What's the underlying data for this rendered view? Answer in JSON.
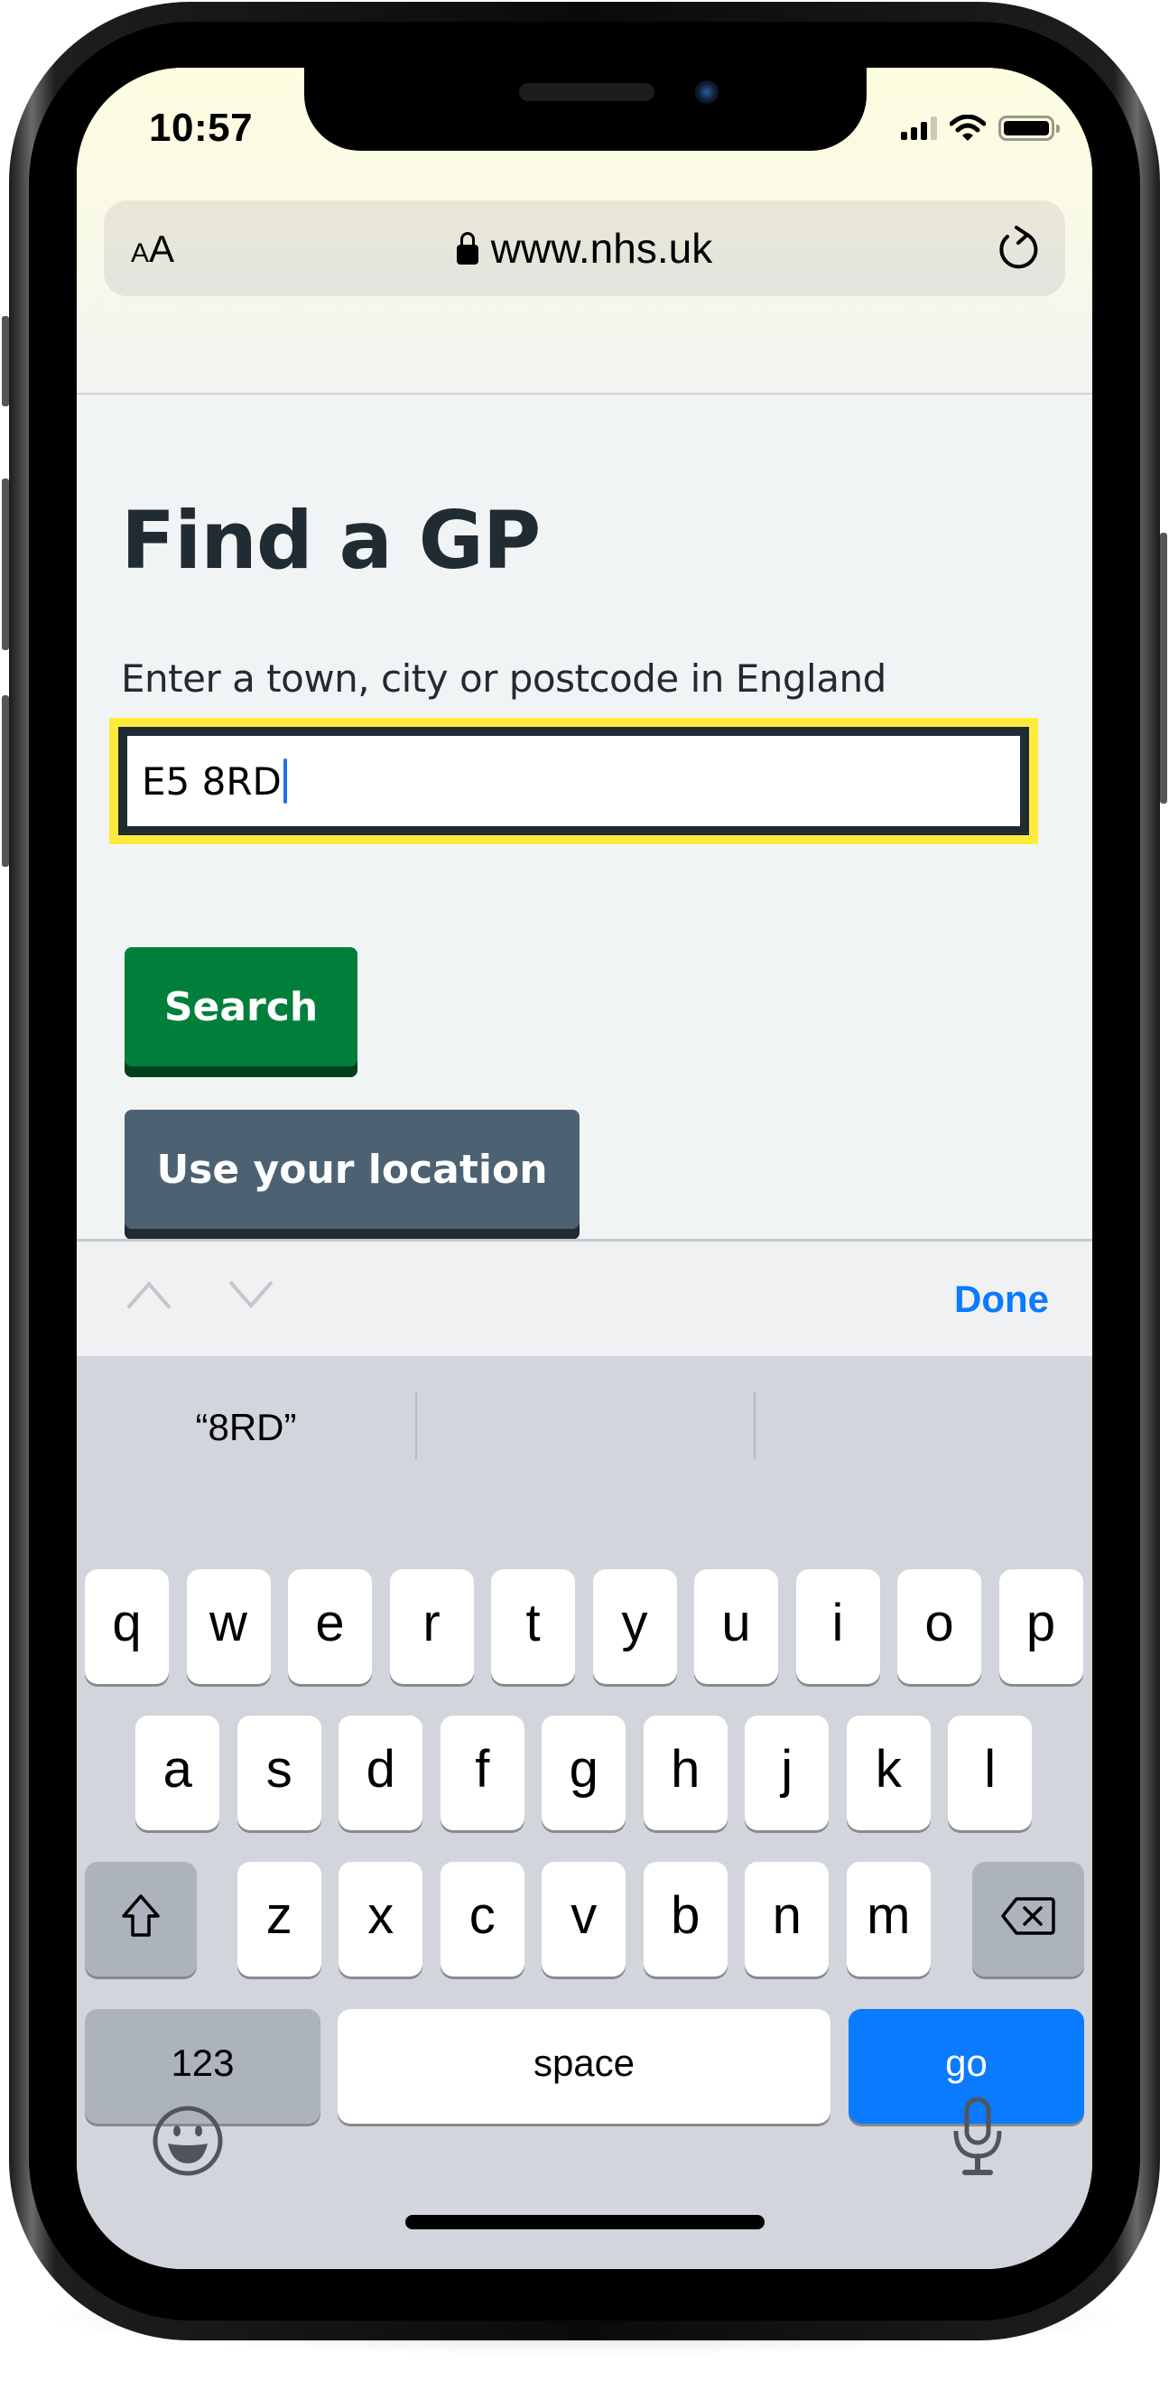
{
  "status_bar": {
    "time": "10:57",
    "icons": [
      "signal-icon",
      "wifi-icon",
      "battery-icon"
    ]
  },
  "browser": {
    "text_size_label_small": "A",
    "text_size_label_big": "A",
    "url": "www.nhs.uk",
    "lock_icon": "lock-icon",
    "reload_icon": "reload-icon"
  },
  "page": {
    "title": "Find a GP",
    "search_label": "Enter a town, city or postcode in England",
    "search_value": "E5 8RD",
    "search_button": "Search",
    "location_button": "Use your location",
    "colors": {
      "focus": "#ffeb3b",
      "primary_button": "#007f3b",
      "secondary_button": "#4c6272",
      "text": "#212b32"
    }
  },
  "accessory_bar": {
    "prev_icon": "chevron-up-icon",
    "next_icon": "chevron-down-icon",
    "done_label": "Done"
  },
  "keyboard": {
    "suggestions": [
      "“8RD”",
      "",
      ""
    ],
    "row1": [
      "q",
      "w",
      "e",
      "r",
      "t",
      "y",
      "u",
      "i",
      "o",
      "p"
    ],
    "row2": [
      "a",
      "s",
      "d",
      "f",
      "g",
      "h",
      "j",
      "k",
      "l"
    ],
    "row3": [
      "z",
      "x",
      "c",
      "v",
      "b",
      "n",
      "m"
    ],
    "numbers_label": "123",
    "space_label": "space",
    "go_label": "go",
    "shift_icon": "shift-icon",
    "delete_icon": "delete-icon",
    "emoji_icon": "emoji-icon",
    "mic_icon": "microphone-icon",
    "accent_color": "#0a7aff"
  }
}
